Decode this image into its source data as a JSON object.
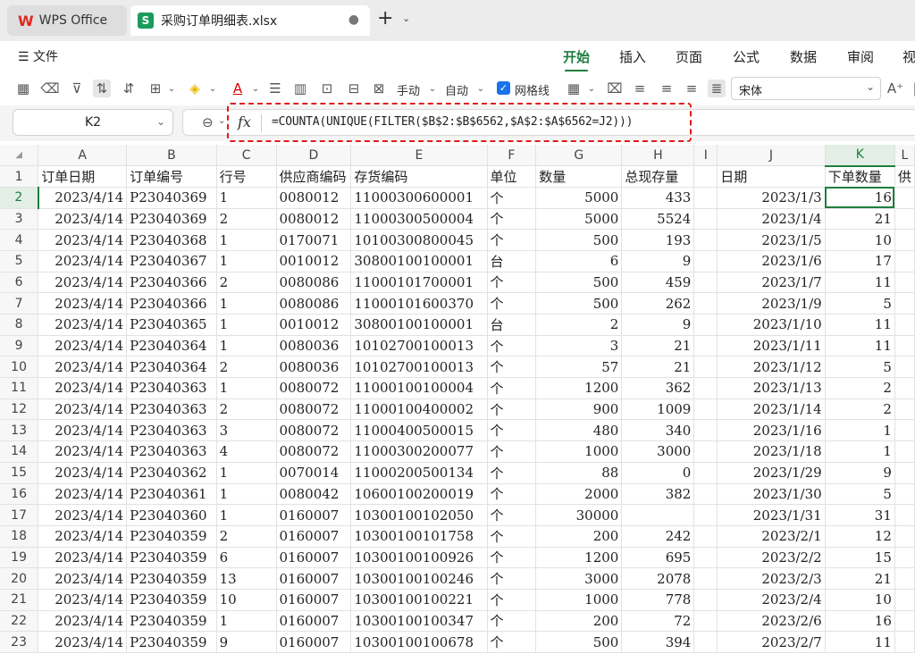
{
  "tabs": {
    "app_label": "WPS Office",
    "file_icon": "S",
    "file_name": "采购订单明细表.xlsx",
    "dot": "●",
    "add": "+",
    "add_chevron": "⌄"
  },
  "menu": {
    "file_label": "文件",
    "tabs": [
      "开始",
      "插入",
      "页面",
      "公式",
      "数据",
      "审阅",
      "视"
    ],
    "active_tab": "开始"
  },
  "toolbar": {
    "manual_label": "手动",
    "auto_label": "自动",
    "gridlines_label": "网格线",
    "font_name": "宋体"
  },
  "formula_bar": {
    "cell_ref": "K2",
    "fx": "fx",
    "formula": "=COUNTA(UNIQUE(FILTER($B$2:$B$6562,$A$2:$A$6562=J2)))"
  },
  "sheet": {
    "columns": [
      "A",
      "B",
      "C",
      "D",
      "E",
      "F",
      "G",
      "H",
      "I",
      "J",
      "K",
      "L"
    ],
    "selected_column": "K",
    "header_row": [
      "订单日期",
      "订单编号",
      "行号",
      "供应商编码",
      "存货编码",
      "单位",
      "数量",
      "总现存量",
      "",
      "日期",
      "下单数量",
      "供"
    ],
    "rows": [
      [
        "2023/4/14",
        "P23040369",
        "1",
        "0080012",
        "11000300600001",
        "个",
        "5000",
        "433",
        "",
        "2023/1/3",
        "16"
      ],
      [
        "2023/4/14",
        "P23040369",
        "2",
        "0080012",
        "11000300500004",
        "个",
        "5000",
        "5524",
        "",
        "2023/1/4",
        "21"
      ],
      [
        "2023/4/14",
        "P23040368",
        "1",
        "0170071",
        "10100300800045",
        "个",
        "500",
        "193",
        "",
        "2023/1/5",
        "10"
      ],
      [
        "2023/4/14",
        "P23040367",
        "1",
        "0010012",
        "30800100100001",
        "台",
        "6",
        "9",
        "",
        "2023/1/6",
        "17"
      ],
      [
        "2023/4/14",
        "P23040366",
        "2",
        "0080086",
        "11000101700001",
        "个",
        "500",
        "459",
        "",
        "2023/1/7",
        "11"
      ],
      [
        "2023/4/14",
        "P23040366",
        "1",
        "0080086",
        "11000101600370",
        "个",
        "500",
        "262",
        "",
        "2023/1/9",
        "5"
      ],
      [
        "2023/4/14",
        "P23040365",
        "1",
        "0010012",
        "30800100100001",
        "台",
        "2",
        "9",
        "",
        "2023/1/10",
        "11"
      ],
      [
        "2023/4/14",
        "P23040364",
        "1",
        "0080036",
        "10102700100013",
        "个",
        "3",
        "21",
        "",
        "2023/1/11",
        "11"
      ],
      [
        "2023/4/14",
        "P23040364",
        "2",
        "0080036",
        "10102700100013",
        "个",
        "57",
        "21",
        "",
        "2023/1/12",
        "5"
      ],
      [
        "2023/4/14",
        "P23040363",
        "1",
        "0080072",
        "11000100100004",
        "个",
        "1200",
        "362",
        "",
        "2023/1/13",
        "2"
      ],
      [
        "2023/4/14",
        "P23040363",
        "2",
        "0080072",
        "11000100400002",
        "个",
        "900",
        "1009",
        "",
        "2023/1/14",
        "2"
      ],
      [
        "2023/4/14",
        "P23040363",
        "3",
        "0080072",
        "11000400500015",
        "个",
        "480",
        "340",
        "",
        "2023/1/16",
        "1"
      ],
      [
        "2023/4/14",
        "P23040363",
        "4",
        "0080072",
        "11000300200077",
        "个",
        "1000",
        "3000",
        "",
        "2023/1/18",
        "1"
      ],
      [
        "2023/4/14",
        "P23040362",
        "1",
        "0070014",
        "11000200500134",
        "个",
        "88",
        "0",
        "",
        "2023/1/29",
        "9"
      ],
      [
        "2023/4/14",
        "P23040361",
        "1",
        "0080042",
        "10600100200019",
        "个",
        "2000",
        "382",
        "",
        "2023/1/30",
        "5"
      ],
      [
        "2023/4/14",
        "P23040360",
        "1",
        "0160007",
        "10300100102050",
        "个",
        "30000",
        "",
        "",
        "2023/1/31",
        "31"
      ],
      [
        "2023/4/14",
        "P23040359",
        "2",
        "0160007",
        "10300100101758",
        "个",
        "200",
        "242",
        "",
        "2023/2/1",
        "12"
      ],
      [
        "2023/4/14",
        "P23040359",
        "6",
        "0160007",
        "10300100100926",
        "个",
        "1200",
        "695",
        "",
        "2023/2/2",
        "15"
      ],
      [
        "2023/4/14",
        "P23040359",
        "13",
        "0160007",
        "10300100100246",
        "个",
        "3000",
        "2078",
        "",
        "2023/2/3",
        "21"
      ],
      [
        "2023/4/14",
        "P23040359",
        "10",
        "0160007",
        "10300100100221",
        "个",
        "1000",
        "778",
        "",
        "2023/2/4",
        "10"
      ],
      [
        "2023/4/14",
        "P23040359",
        "1",
        "0160007",
        "10300100100347",
        "个",
        "200",
        "72",
        "",
        "2023/2/6",
        "16"
      ],
      [
        "2023/4/14",
        "P23040359",
        "9",
        "0160007",
        "10300100100678",
        "个",
        "500",
        "394",
        "",
        "2023/2/7",
        "11"
      ]
    ]
  },
  "colors": {
    "accent": "#1e7e3e",
    "highlight": "#e01b1b",
    "selection": "#e3efe6"
  }
}
